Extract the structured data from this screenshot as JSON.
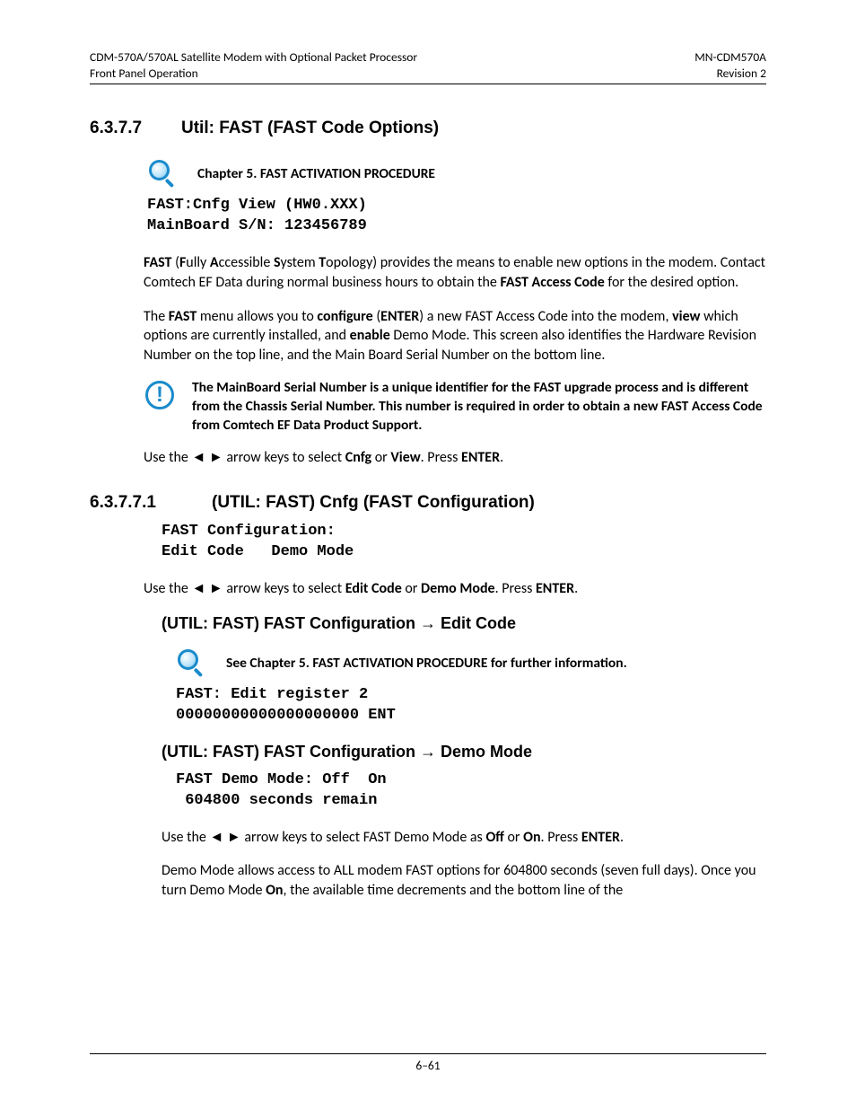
{
  "header": {
    "left_line1": "CDM-570A/570AL Satellite Modem with Optional Packet Processor",
    "left_line2": "Front Panel Operation",
    "right_line1": "MN-CDM570A",
    "right_line2": "Revision 2"
  },
  "section1": {
    "number": "6.3.7.7",
    "title": "Util: FAST (FAST Code Options)"
  },
  "note_chapter5": "Chapter 5. FAST ACTIVATION PROCEDURE",
  "code_fast_cnfg": "FAST:Cnfg View (HW0.XXX)\nMainBoard S/N: 123456789",
  "para_fast_acronym": {
    "p1a": "FAST",
    "p1b": " (",
    "p1c": "F",
    "p1d": "ully ",
    "p1e": "A",
    "p1f": "ccessible ",
    "p1g": "S",
    "p1h": "ystem ",
    "p1i": "T",
    "p1j": "opology) provides the means to enable new options in the modem. Contact Comtech EF Data during normal business hours to obtain the ",
    "p1k": "FAST Access Code",
    "p1l": " for the desired option."
  },
  "para_fast_menu": {
    "a": "The ",
    "b": "FAST",
    "c": " menu allows you to ",
    "d": "configure",
    "e": " (",
    "f": "ENTER",
    "g": ") a new FAST Access Code into the modem, ",
    "h": "view",
    "i": " which options are currently installed, and ",
    "j": "enable",
    "k": " Demo Mode. This screen also identifies the Hardware Revision Number on the top line, and the Main Board Serial Number on the bottom line."
  },
  "alert_mainboard": "The MainBoard Serial Number is a unique identifier for the FAST upgrade process and is different from the Chassis Serial Number. This number is required in order to obtain a new FAST Access Code from Comtech EF Data Product Support.",
  "para_use_arrows_cnfg": {
    "a": "Use the ◄ ► arrow keys to select ",
    "b": "Cnfg",
    "c": " or ",
    "d": "View",
    "e": ". Press ",
    "f": "ENTER",
    "g": "."
  },
  "section2": {
    "number": "6.3.7.7.1",
    "title": "(UTIL: FAST) Cnfg (FAST Configuration)"
  },
  "code_fast_config": "FAST Configuration:\nEdit Code   Demo Mode",
  "para_use_arrows_edit": {
    "a": "Use the ◄ ► arrow keys to select ",
    "b": "Edit Code",
    "c": " or ",
    "d": "Demo Mode",
    "e": ". Press ",
    "f": "ENTER",
    "g": "."
  },
  "heading_edit_code": "(UTIL: FAST) FAST Configuration → Edit Code",
  "note_see_chapter5": "See Chapter 5. FAST ACTIVATION PROCEDURE for further information.",
  "code_edit_register": "FAST: Edit register 2\n00000000000000000000 ENT",
  "heading_demo_mode": "(UTIL: FAST) FAST Configuration → Demo Mode",
  "code_demo_mode": "FAST Demo Mode: Off  On\n 604800 seconds remain",
  "para_use_arrows_demo": {
    "a": "Use the ◄ ► arrow keys to select FAST Demo Mode as ",
    "b": "Off",
    "c": " or ",
    "d": "On",
    "e": ". Press ",
    "f": "ENTER",
    "g": "."
  },
  "para_demo_desc": {
    "a": "Demo Mode allows access to ALL modem FAST options for 604800 seconds (seven full days). Once you turn Demo Mode ",
    "b": "On",
    "c": ", the available time decrements and the bottom line of the"
  },
  "footer": "6–61"
}
